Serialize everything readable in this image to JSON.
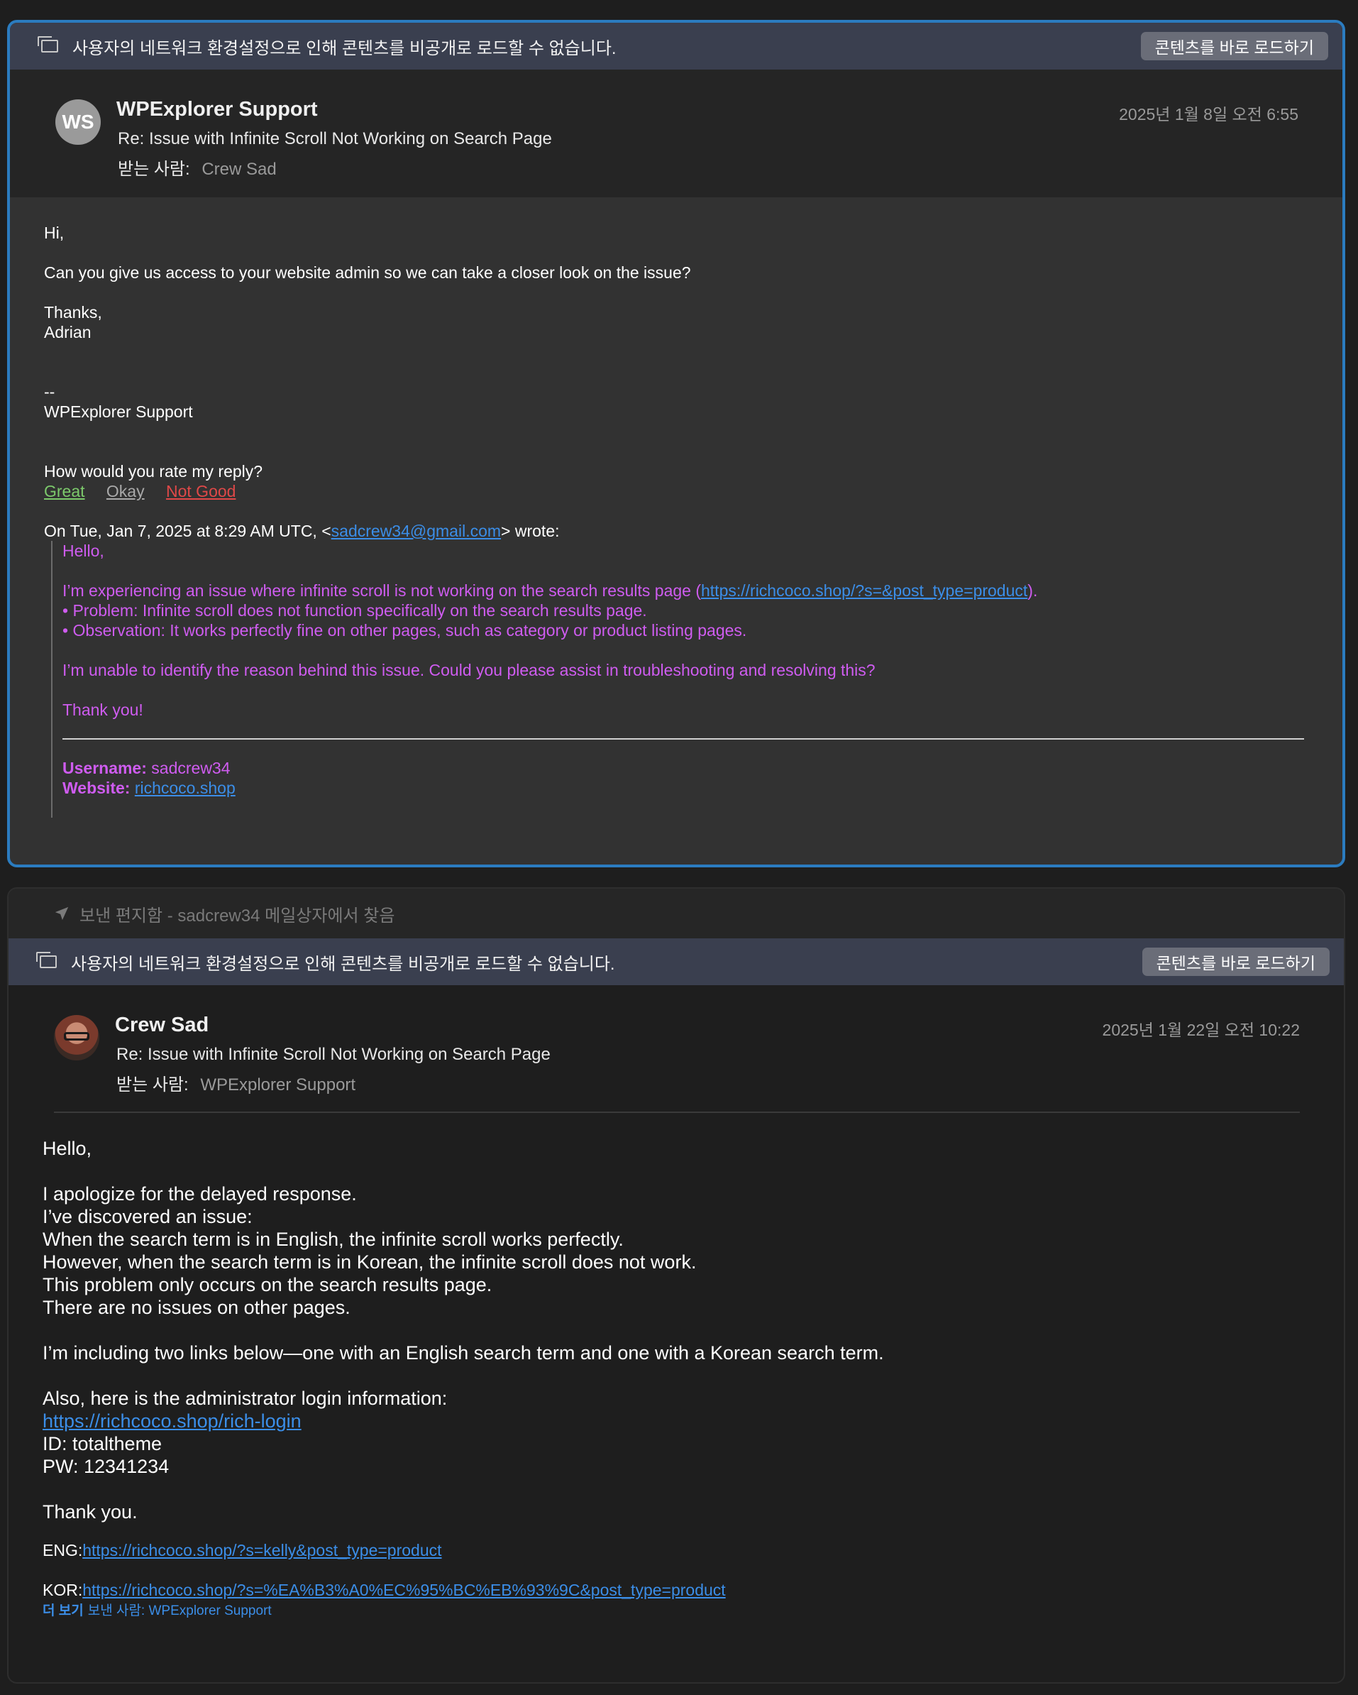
{
  "banner": {
    "text": "사용자의 네트워크 환경설정으로 인해 콘텐츠를 비공개로 로드할 수 없습니다.",
    "button": "콘텐츠를 바로 로드하기"
  },
  "message1": {
    "avatar_initials": "WS",
    "from": "WPExplorer Support",
    "subject": "Re: Issue with Infinite Scroll Not Working on Search Page",
    "to_label": "받는 사람:",
    "to": "Crew Sad",
    "date": "2025년 1월 8일 오전 6:55",
    "greeting": "Hi,",
    "line1": "Can you give us access to your website admin so we can take a closer look on the issue?",
    "thanks": "Thanks,",
    "name": "Adrian",
    "sig_dash": "--",
    "sig": "WPExplorer Support",
    "rate_q": "How would you rate my reply?",
    "rate_great": "Great",
    "rate_okay": "Okay",
    "rate_bad": "Not Good",
    "wrote_prefix": "On Tue, Jan 7, 2025 at 8:29 AM UTC, <",
    "wrote_email": "sadcrew34@gmail.com",
    "wrote_suffix": "> wrote:",
    "quote": {
      "hello": "Hello,",
      "issue_prefix": "I’m experiencing an issue where infinite scroll is not working on the search results page (",
      "issue_link": "https://richcoco.shop/?s=&post_type=product",
      "issue_suffix": ").",
      "problem": "• Problem: Infinite scroll does not function specifically on the search results page.",
      "observation": "• Observation: It works perfectly fine on other pages, such as category or product listing pages.",
      "unable": "I’m unable to identify the reason behind this issue. Could you please assist in troubleshooting and resolving this?",
      "thankyou": "Thank you!",
      "username_label": "Username:",
      "username": "sadcrew34",
      "website_label": "Website:",
      "website": "richcoco.shop"
    }
  },
  "folder_row": "보낸 편지함 - sadcrew34 메일상자에서 찾음",
  "message2": {
    "from": "Crew Sad",
    "subject": "Re: Issue with Infinite Scroll Not Working on Search Page",
    "to_label": "받는 사람:",
    "to": "WPExplorer Support",
    "date": "2025년 1월 22일 오전 10:22",
    "hello": "Hello,",
    "lines": [
      "I apologize for the delayed response.",
      "I’ve discovered an issue:",
      "When the search term is in English, the infinite scroll works perfectly.",
      "However, when the search term is in Korean, the infinite scroll does not work.",
      "This problem only occurs on the search results page.",
      "There are no issues on other pages."
    ],
    "links_intro": "I’m including two links below—one with an English search term and one with a Korean search term.",
    "admin_intro": "Also, here is the administrator login information:",
    "admin_link": "https://richcoco.shop/rich-login",
    "id_line": "ID: totaltheme",
    "pw_line": "PW: 12341234",
    "thankyou": "Thank you.",
    "eng_label": "ENG:",
    "eng_link": "https://richcoco.shop/?s=kelly&post_type=product",
    "kor_label": "KOR:",
    "kor_link": "https://richcoco.shop/?s=%EA%B3%A0%EC%95%BC%EB%93%9C&post_type=product",
    "more": "더 보기",
    "more_from": "보낸 사람: WPExplorer Support"
  },
  "colors": {
    "accent_border": "#2b7cc0",
    "link": "#3b8ee8",
    "quote_text": "#cf5cf0",
    "rate_great": "#7cc96b",
    "rate_bad": "#e04848"
  }
}
